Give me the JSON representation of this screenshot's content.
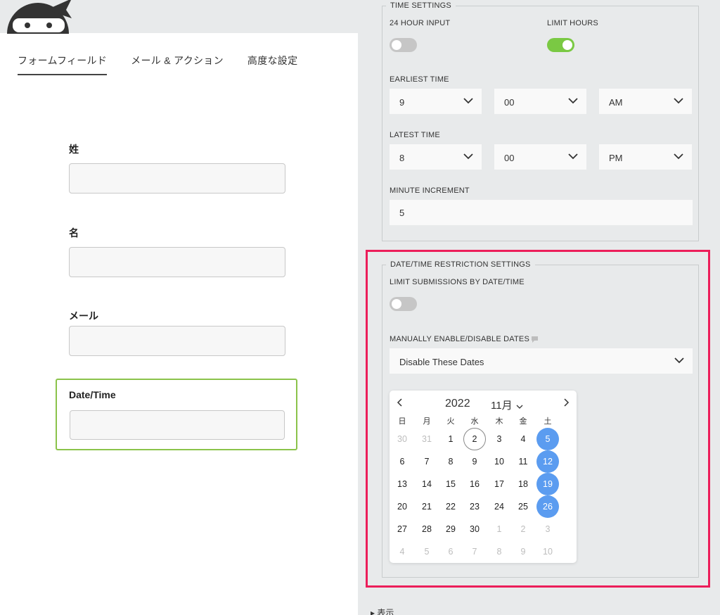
{
  "tabs": [
    {
      "label": "フォームフィールド"
    },
    {
      "label": "メール & アクション"
    },
    {
      "label": "高度な設定"
    }
  ],
  "form_fields": [
    {
      "label": "姓"
    },
    {
      "label": "名"
    },
    {
      "label": "メール"
    },
    {
      "label": "Date/Time"
    }
  ],
  "time_settings": {
    "legend": "TIME SETTINGS",
    "hour24_label": "24 HOUR INPUT",
    "hour24_on": false,
    "limit_hours_label": "LIMIT HOURS",
    "limit_hours_on": true,
    "earliest_label": "EARLIEST TIME",
    "earliest": {
      "hour": "9",
      "minute": "00",
      "ampm": "AM"
    },
    "latest_label": "LATEST TIME",
    "latest": {
      "hour": "8",
      "minute": "00",
      "ampm": "PM"
    },
    "increment_label": "MINUTE INCREMENT",
    "increment_value": "5"
  },
  "restriction": {
    "legend": "DATE/TIME RESTRICTION SETTINGS",
    "limit_label": "LIMIT SUBMISSIONS BY DATE/TIME",
    "limit_on": false,
    "manual_label": "MANUALLY ENABLE/DISABLE DATES",
    "manual_value": "Disable These Dates"
  },
  "calendar": {
    "year": "2022",
    "month": "11月",
    "weekdays": [
      "日",
      "月",
      "火",
      "水",
      "木",
      "金",
      "土"
    ],
    "weeks": [
      [
        {
          "d": "30",
          "o": true
        },
        {
          "d": "31",
          "o": true
        },
        {
          "d": "1"
        },
        {
          "d": "2",
          "today": true
        },
        {
          "d": "3"
        },
        {
          "d": "4"
        },
        {
          "d": "5",
          "sel": true
        }
      ],
      [
        {
          "d": "6"
        },
        {
          "d": "7"
        },
        {
          "d": "8"
        },
        {
          "d": "9"
        },
        {
          "d": "10"
        },
        {
          "d": "11"
        },
        {
          "d": "12",
          "sel": true
        }
      ],
      [
        {
          "d": "13"
        },
        {
          "d": "14"
        },
        {
          "d": "15"
        },
        {
          "d": "16"
        },
        {
          "d": "17"
        },
        {
          "d": "18"
        },
        {
          "d": "19",
          "sel": true
        }
      ],
      [
        {
          "d": "20"
        },
        {
          "d": "21"
        },
        {
          "d": "22"
        },
        {
          "d": "23"
        },
        {
          "d": "24"
        },
        {
          "d": "25"
        },
        {
          "d": "26",
          "sel": true
        }
      ],
      [
        {
          "d": "27"
        },
        {
          "d": "28"
        },
        {
          "d": "29"
        },
        {
          "d": "30"
        },
        {
          "d": "1",
          "o": true
        },
        {
          "d": "2",
          "o": true
        },
        {
          "d": "3",
          "o": true
        }
      ],
      [
        {
          "d": "4",
          "o": true
        },
        {
          "d": "5",
          "o": true
        },
        {
          "d": "6",
          "o": true
        },
        {
          "d": "7",
          "o": true
        },
        {
          "d": "8",
          "o": true
        },
        {
          "d": "9",
          "o": true
        },
        {
          "d": "10",
          "o": true
        }
      ]
    ]
  },
  "display_section_label": "表示",
  "colors": {
    "highlight": "#ec1e5a",
    "toggle_on": "#7ac943",
    "selected_day": "#5b9cf0",
    "field_focus_border": "#8bc34a"
  },
  "icons": {
    "logo": "ninja-logo-icon",
    "chevron": "chevron-down-icon",
    "help": "help-tooltip-icon",
    "prev": "chevron-left-icon",
    "next": "chevron-right-icon"
  }
}
